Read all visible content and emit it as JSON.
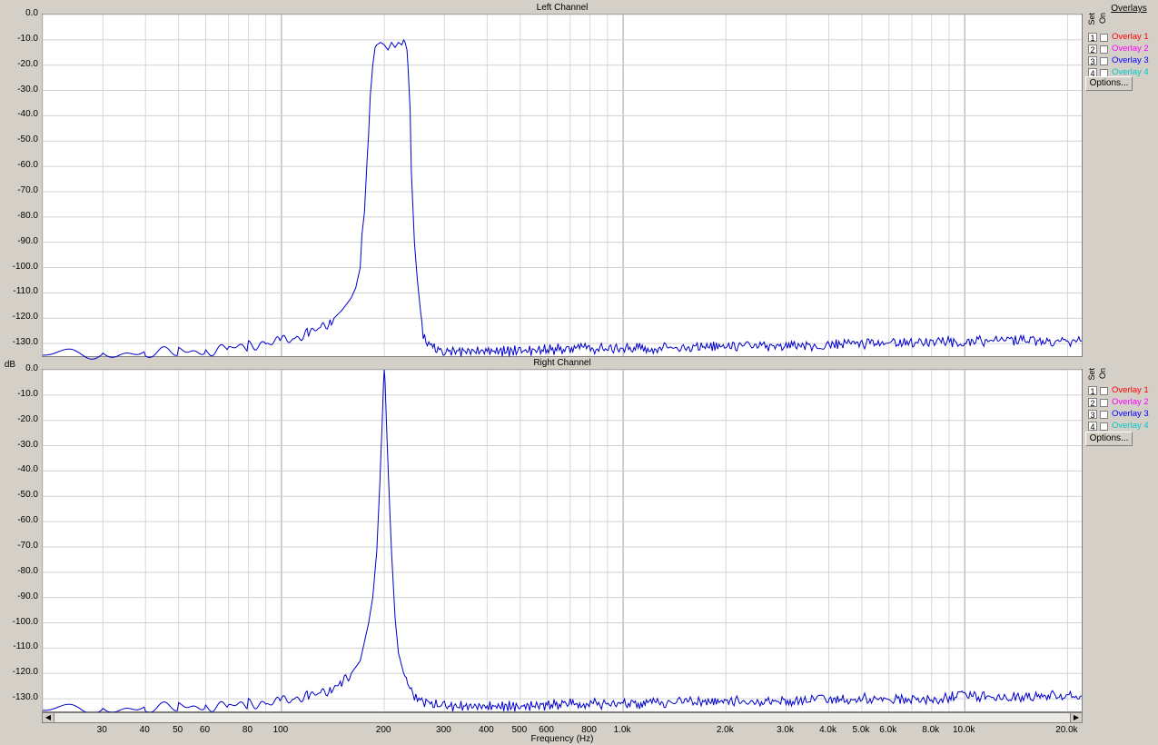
{
  "axis": {
    "ylabel": "dB",
    "xlabel": "Frequency (Hz)",
    "y_ticks": [
      "0.0",
      "-10.0",
      "-20.0",
      "-30.0",
      "-40.0",
      "-50.0",
      "-60.0",
      "-70.0",
      "-80.0",
      "-90.0",
      "-100.0",
      "-110.0",
      "-120.0",
      "-130.0"
    ],
    "x_tick_labels": [
      {
        "hz": 30,
        "label": "30"
      },
      {
        "hz": 40,
        "label": "40"
      },
      {
        "hz": 50,
        "label": "50"
      },
      {
        "hz": 60,
        "label": "60"
      },
      {
        "hz": 80,
        "label": "80"
      },
      {
        "hz": 100,
        "label": "100"
      },
      {
        "hz": 200,
        "label": "200"
      },
      {
        "hz": 300,
        "label": "300"
      },
      {
        "hz": 400,
        "label": "400"
      },
      {
        "hz": 500,
        "label": "500"
      },
      {
        "hz": 600,
        "label": "600"
      },
      {
        "hz": 800,
        "label": "800"
      },
      {
        "hz": 1000,
        "label": "1.0k"
      },
      {
        "hz": 2000,
        "label": "2.0k"
      },
      {
        "hz": 3000,
        "label": "3.0k"
      },
      {
        "hz": 4000,
        "label": "4.0k"
      },
      {
        "hz": 5000,
        "label": "5.0k"
      },
      {
        "hz": 6000,
        "label": "6.0k"
      },
      {
        "hz": 8000,
        "label": "8.0k"
      },
      {
        "hz": 10000,
        "label": "10.0k"
      },
      {
        "hz": 20000,
        "label": "20.0k"
      }
    ]
  },
  "overlays_panel": {
    "heading": "Overlays",
    "col_set": "Set",
    "col_on": "On",
    "items": [
      {
        "num": "1",
        "name": "Overlay 1",
        "color": "#ff0000"
      },
      {
        "num": "2",
        "name": "Overlay 2",
        "color": "#ff00ff"
      },
      {
        "num": "3",
        "name": "Overlay 3",
        "color": "#0000ff"
      },
      {
        "num": "4",
        "name": "Overlay 4",
        "color": "#00c8c8"
      }
    ],
    "options_label": "Options..."
  },
  "chart_data": [
    {
      "type": "line",
      "title": "Left Channel",
      "xscale": "log",
      "xlim": [
        20,
        22000
      ],
      "ylim": [
        -135,
        0
      ],
      "grid": true,
      "line_color": "#0000cc",
      "series": [
        {
          "x": [
            20,
            30,
            40,
            50,
            60,
            70,
            80,
            90,
            100,
            110,
            120,
            130,
            140,
            150,
            160,
            165,
            170,
            172,
            175,
            178,
            180,
            182,
            185,
            188,
            190,
            195,
            200,
            205,
            210,
            215,
            220,
            225,
            228,
            230,
            233,
            235,
            238,
            240,
            245,
            250,
            260,
            280,
            300,
            400,
            500,
            700,
            1000,
            2000,
            3000,
            5000,
            8000,
            10000,
            15000,
            20000,
            22000
          ],
          "y": [
            -134,
            -134,
            -134,
            -133,
            -133,
            -132,
            -131,
            -130,
            -129,
            -128,
            -126,
            -124,
            -121,
            -117,
            -112,
            -108,
            -100,
            -87,
            -78,
            -58,
            -47,
            -32,
            -20,
            -13,
            -12,
            -11,
            -12,
            -14,
            -11,
            -13,
            -11,
            -12,
            -10,
            -11,
            -14,
            -22,
            -38,
            -62,
            -90,
            -105,
            -128,
            -132,
            -133,
            -133,
            -133,
            -132,
            -132,
            -131,
            -131,
            -130,
            -130,
            -129,
            -129,
            -129,
            -129
          ]
        }
      ]
    },
    {
      "type": "line",
      "title": "Right Channel",
      "xscale": "log",
      "xlim": [
        20,
        22000
      ],
      "ylim": [
        -135,
        0
      ],
      "grid": true,
      "line_color": "#0000cc",
      "series": [
        {
          "x": [
            20,
            30,
            40,
            50,
            60,
            70,
            80,
            90,
            100,
            110,
            120,
            130,
            140,
            150,
            160,
            170,
            180,
            185,
            190,
            194,
            197,
            199,
            200,
            201,
            203,
            206,
            210,
            215,
            220,
            230,
            240,
            250,
            270,
            300,
            400,
            500,
            700,
            1000,
            2000,
            3000,
            5000,
            8000,
            10000,
            15000,
            20000,
            22000
          ],
          "y": [
            -134,
            -134,
            -134,
            -133,
            -133,
            -133,
            -132,
            -132,
            -131,
            -130,
            -129,
            -128,
            -126,
            -124,
            -120,
            -115,
            -100,
            -90,
            -72,
            -45,
            -22,
            -5,
            0,
            -5,
            -22,
            -45,
            -72,
            -98,
            -112,
            -122,
            -127,
            -130,
            -132,
            -133,
            -133,
            -133,
            -132,
            -132,
            -131,
            -131,
            -130,
            -130,
            -129,
            -129,
            -129,
            -129
          ]
        }
      ]
    }
  ]
}
